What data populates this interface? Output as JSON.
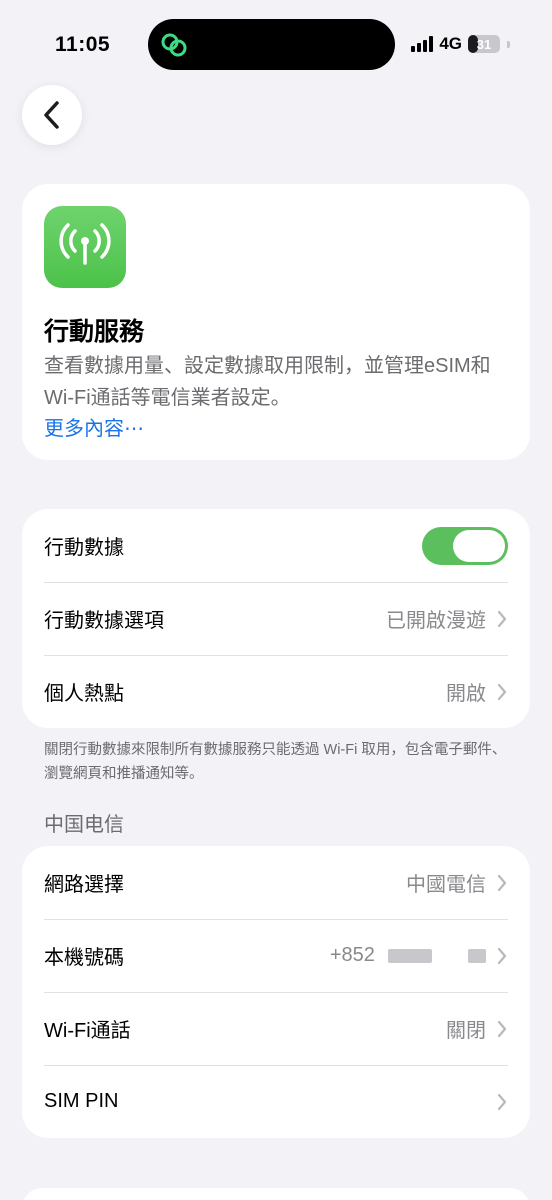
{
  "status_bar": {
    "time": "11:05",
    "network": "4G",
    "battery": "31",
    "battery_level": 0.31,
    "island_icon": "link-loop-icon",
    "signal_icon": "cellular-signal-icon"
  },
  "nav": {
    "back_icon": "chevron-left-icon"
  },
  "info": {
    "icon": "antenna-icon",
    "title": "行動服務",
    "description": "查看數據用量、設定數據取用限制，並管理eSIM和Wi-Fi通話等電信業者設定。",
    "link": "更多內容⋯"
  },
  "data_group": {
    "rows": [
      {
        "label": "行動數據",
        "toggle_on": true
      },
      {
        "label": "行動數據選項",
        "value": "已開啟漫遊"
      },
      {
        "label": "個人熱點",
        "value": "開啟"
      }
    ],
    "note": "關閉行動數據來限制所有數據服務只能透過 Wi-Fi 取用，包含電子郵件、瀏覽網頁和推播通知等。"
  },
  "carrier_group": {
    "header": "中国电信",
    "rows": [
      {
        "label": "網路選擇",
        "value": "中國電信"
      },
      {
        "label": "本機號碼",
        "value": "+852"
      },
      {
        "label": "Wi-Fi通話",
        "value": "關閉"
      },
      {
        "label": "SIM PIN",
        "value": ""
      }
    ]
  },
  "colors": {
    "background": "#f2f2f7",
    "accent_green": "#5cbf5e",
    "link_blue": "#1a73e8",
    "secondary_text": "#8a8a8e"
  }
}
